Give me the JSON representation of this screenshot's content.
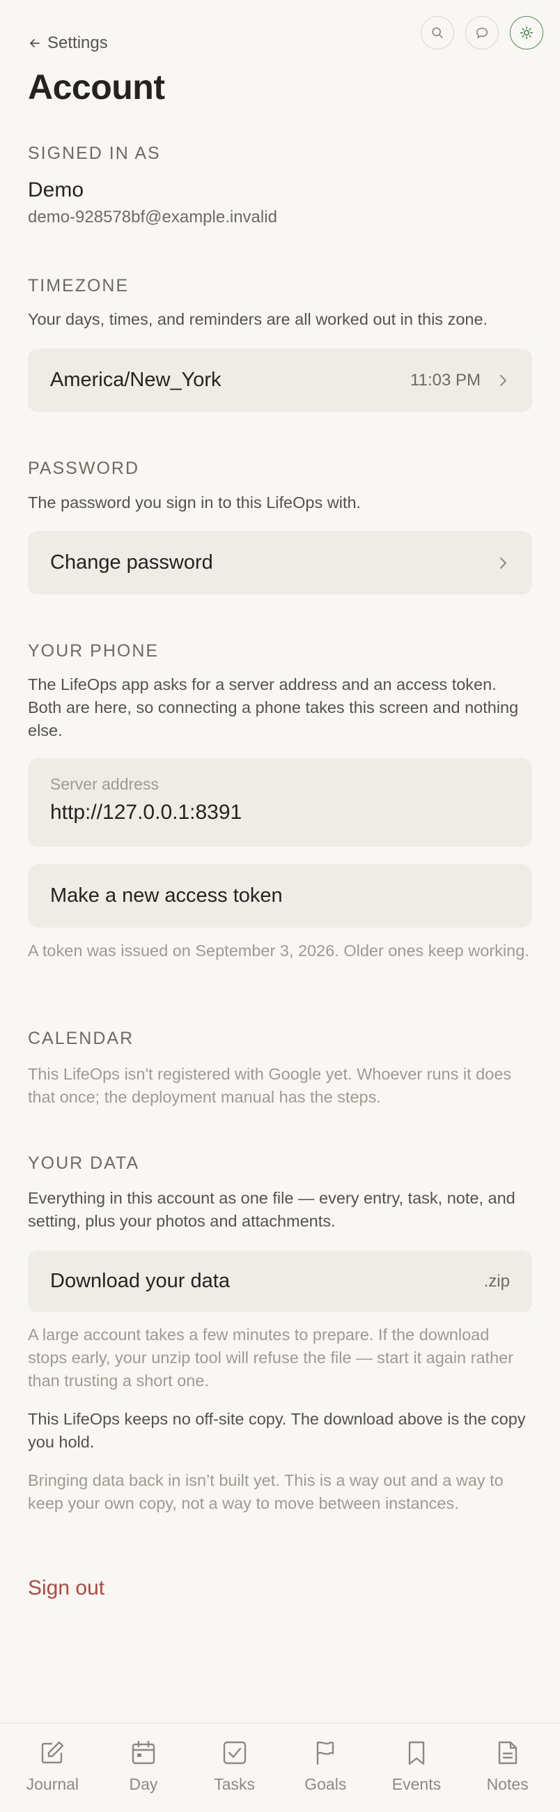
{
  "header": {
    "back_label": "Settings",
    "title": "Account",
    "icons": [
      "search-icon",
      "chat-bubble-icon",
      "sun-icon"
    ]
  },
  "signed_in": {
    "heading": "SIGNED IN AS",
    "name": "Demo",
    "email": "demo-928578bf@example.invalid"
  },
  "timezone": {
    "heading": "TIMEZONE",
    "description": "Your days, times, and reminders are all worked out in this zone.",
    "value": "America/New_York",
    "local_time": "11:03 PM"
  },
  "password": {
    "heading": "PASSWORD",
    "description": "The password you sign in to this LifeOps with.",
    "action": "Change password"
  },
  "phone": {
    "heading": "YOUR PHONE",
    "description": "The LifeOps app asks for a server address and an access token. Both are here, so connecting a phone takes this screen and nothing else.",
    "server_label": "Server address",
    "server_value": "http://127.0.0.1:8391",
    "token_action": "Make a new access token",
    "token_note": "A token was issued on September 3, 2026. Older ones keep working."
  },
  "calendar": {
    "heading": "CALENDAR",
    "note": "This LifeOps isn't registered with Google yet. Whoever runs it does that once; the deployment manual has the steps."
  },
  "data": {
    "heading": "YOUR DATA",
    "description": "Everything in this account as one file — every entry, task, note, and setting, plus your photos and attachments.",
    "download_action": "Download your data",
    "download_format": ".zip",
    "note_large": "A large account takes a few minutes to prepare. If the download stops early, your unzip tool will refuse the file — start it again rather than trusting a short one.",
    "note_offsite": "This LifeOps keeps no off-site copy. The download above is the copy you hold.",
    "note_import": "Bringing data back in isn’t built yet. This is a way out and a way to keep your own copy, not a way to move between instances."
  },
  "sign_out": "Sign out",
  "nav": [
    {
      "label": "Journal",
      "icon": "pencil-square-icon"
    },
    {
      "label": "Day",
      "icon": "calendar-icon"
    },
    {
      "label": "Tasks",
      "icon": "checkbox-icon"
    },
    {
      "label": "Goals",
      "icon": "flag-icon"
    },
    {
      "label": "Events",
      "icon": "bookmark-icon"
    },
    {
      "label": "Notes",
      "icon": "document-icon"
    }
  ],
  "colors": {
    "background": "#f8f7f4",
    "card": "#efece7",
    "accent_green": "#4f8a55",
    "danger": "#b5473f"
  }
}
